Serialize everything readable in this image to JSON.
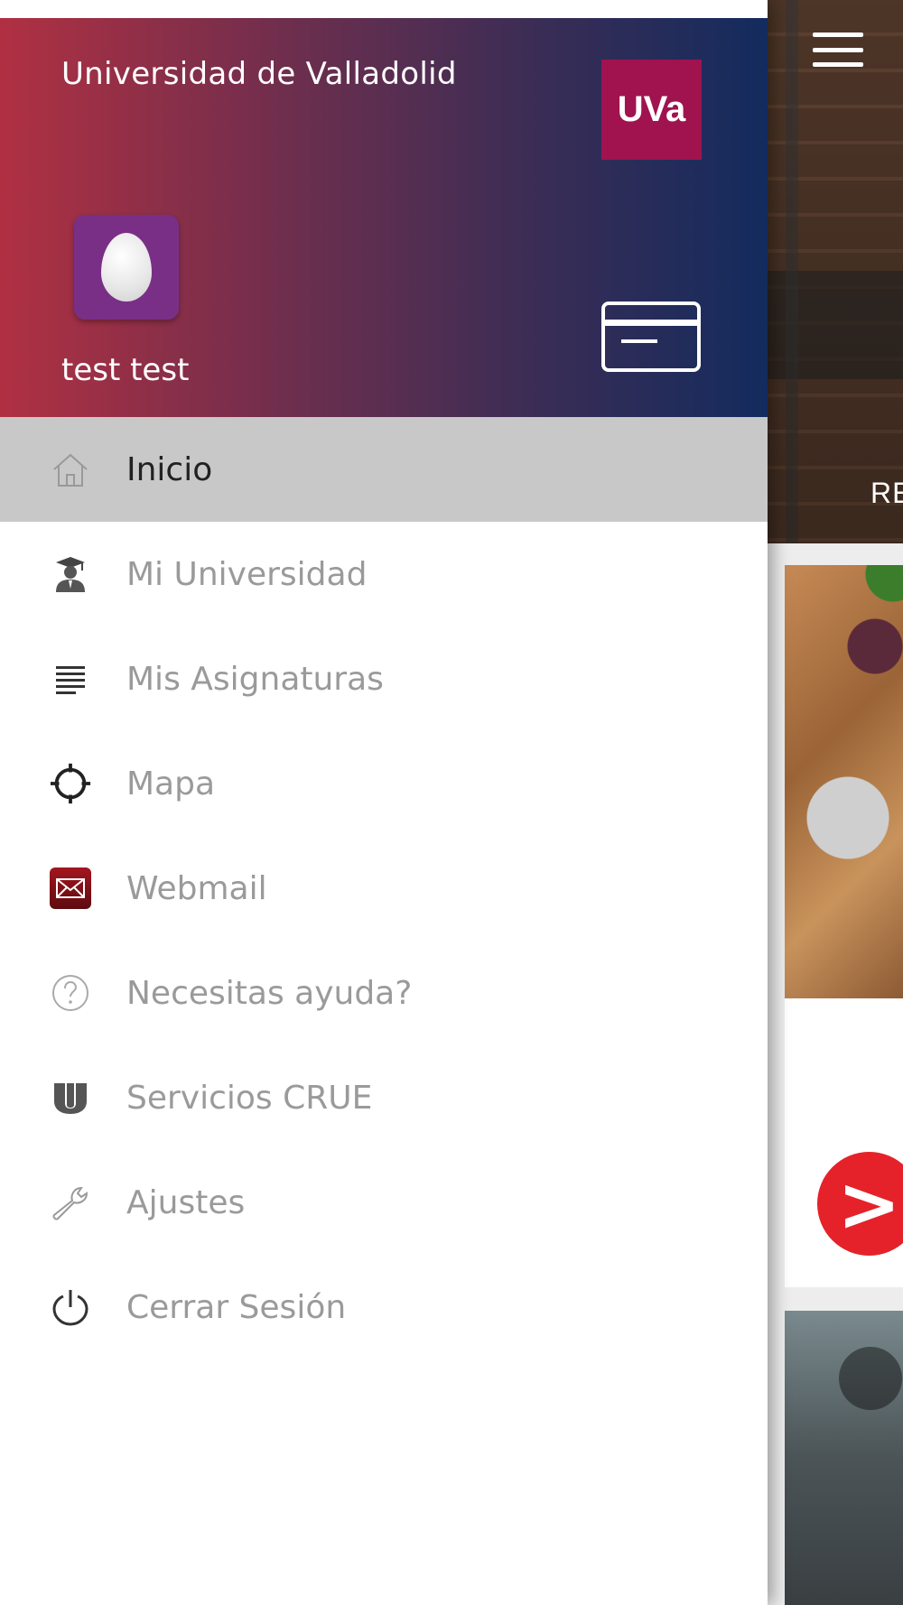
{
  "drawer": {
    "university_name": "Universidad de Valladolid",
    "logo_text": "UVa",
    "username": "test test",
    "menu": [
      {
        "label": "Inicio",
        "icon": "home-icon",
        "active": true
      },
      {
        "label": "Mi Universidad",
        "icon": "graduate-icon",
        "active": false
      },
      {
        "label": "Mis Asignaturas",
        "icon": "list-icon",
        "active": false
      },
      {
        "label": "Mapa",
        "icon": "crosshair-icon",
        "active": false
      },
      {
        "label": "Webmail",
        "icon": "mail-icon",
        "active": false
      },
      {
        "label": "Necesitas ayuda?",
        "icon": "help-icon",
        "active": false
      },
      {
        "label": "Servicios CRUE",
        "icon": "crue-icon",
        "active": false
      },
      {
        "label": "Ajustes",
        "icon": "wrench-icon",
        "active": false
      },
      {
        "label": "Cerrar Sesión",
        "icon": "power-icon",
        "active": false
      }
    ]
  },
  "background": {
    "hero_text": "RE",
    "badge_glyph": ">"
  },
  "colors": {
    "header_gradient_start": "#b03042",
    "header_gradient_end": "#132b5e",
    "logo_bg": "#a0134f",
    "avatar_bg": "#7a2f86",
    "active_item_bg": "#c8c8c8",
    "inactive_text": "#9a9a9a",
    "badge_red": "#e5222a"
  }
}
